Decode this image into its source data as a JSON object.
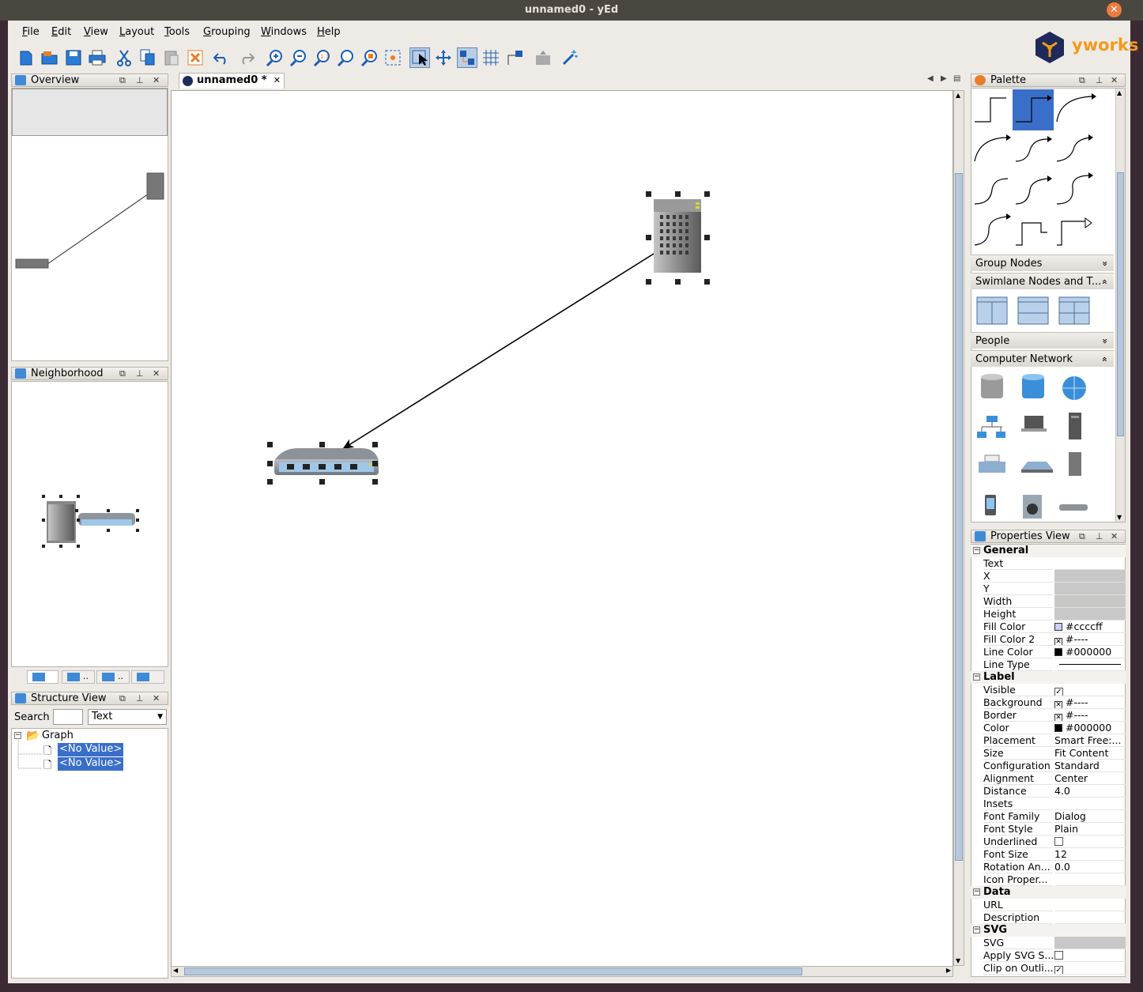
{
  "window": {
    "title": "unnamed0 - yEd",
    "close_glyph": "✕"
  },
  "menu": [
    "File",
    "Edit",
    "View",
    "Layout",
    "Tools",
    "Grouping",
    "Windows",
    "Help"
  ],
  "logo": {
    "text": "yworks"
  },
  "toolbar": {
    "icons": [
      "new-document-icon",
      "open-folder-icon",
      "save-icon",
      "print-icon",
      "cut-icon",
      "copy-icon",
      "paste-icon",
      "delete-icon",
      "undo-icon",
      "redo-icon",
      "zoom-in-icon",
      "zoom-out-icon",
      "zoom-actual-icon",
      "zoom-fit-icon",
      "zoom-selection-icon",
      "fit-content-icon",
      "edit-mode-icon",
      "pan-mode-icon",
      "snap-icon",
      "grid-icon",
      "orthogonal-edges-icon",
      "export-icon",
      "magic-icon"
    ]
  },
  "overview": {
    "title": "Overview"
  },
  "neighborhood": {
    "title": "Neighborhood",
    "tabs": [
      "",
      "..",
      "..",
      ""
    ]
  },
  "structure": {
    "title": "Structure View",
    "search_label": "Search",
    "search_value": "",
    "filter_value": "Text",
    "root": "Graph",
    "items": [
      "<No Value>",
      "<No Value>"
    ]
  },
  "document_tab": {
    "label": "unnamed0 *",
    "close": "✕"
  },
  "palette": {
    "title": "Palette",
    "sections": [
      {
        "label": "Group Nodes",
        "chevron": "»"
      },
      {
        "label": "Swimlane Nodes and T...",
        "chevron": "»"
      },
      {
        "label": "People",
        "chevron": "»"
      },
      {
        "label": "Computer Network",
        "chevron": "»"
      }
    ]
  },
  "properties": {
    "title": "Properties View",
    "general": {
      "header": "General",
      "rows": [
        {
          "k": "Text",
          "v": ""
        },
        {
          "k": "X",
          "v": ""
        },
        {
          "k": "Y",
          "v": ""
        },
        {
          "k": "Width",
          "v": ""
        },
        {
          "k": "Height",
          "v": ""
        },
        {
          "k": "Fill Color",
          "v": "#ccccff"
        },
        {
          "k": "Fill Color 2",
          "v": "#----"
        },
        {
          "k": "Line Color",
          "v": "#000000"
        },
        {
          "k": "Line Type",
          "v": ""
        }
      ]
    },
    "label": {
      "header": "Label",
      "rows": [
        {
          "k": "Visible",
          "v": ""
        },
        {
          "k": "Background",
          "v": "#----"
        },
        {
          "k": "Border",
          "v": "#----"
        },
        {
          "k": "Color",
          "v": "#000000"
        },
        {
          "k": "Placement",
          "v": "Smart Free:..."
        },
        {
          "k": "Size",
          "v": "Fit Content"
        },
        {
          "k": "Configuration",
          "v": "Standard"
        },
        {
          "k": "Alignment",
          "v": "Center"
        },
        {
          "k": "Distance",
          "v": "4.0"
        },
        {
          "k": "Insets",
          "v": ""
        },
        {
          "k": "Font Family",
          "v": "Dialog"
        },
        {
          "k": "Font Style",
          "v": "Plain"
        },
        {
          "k": "Underlined",
          "v": ""
        },
        {
          "k": "Font Size",
          "v": "12"
        },
        {
          "k": "Rotation An...",
          "v": "0.0"
        },
        {
          "k": "Icon Proper...",
          "v": ""
        }
      ]
    },
    "data": {
      "header": "Data",
      "rows": [
        {
          "k": "URL",
          "v": ""
        },
        {
          "k": "Description",
          "v": ""
        }
      ]
    },
    "svg": {
      "header": "SVG",
      "rows": [
        {
          "k": "SVG",
          "v": ""
        },
        {
          "k": "Apply SVG S...",
          "v": ""
        },
        {
          "k": "Clip on Outli...",
          "v": ""
        }
      ]
    }
  },
  "colors": {
    "selection": "#3a6fc9",
    "fill_color": "#ccccff",
    "accent": "#f07b3f"
  }
}
